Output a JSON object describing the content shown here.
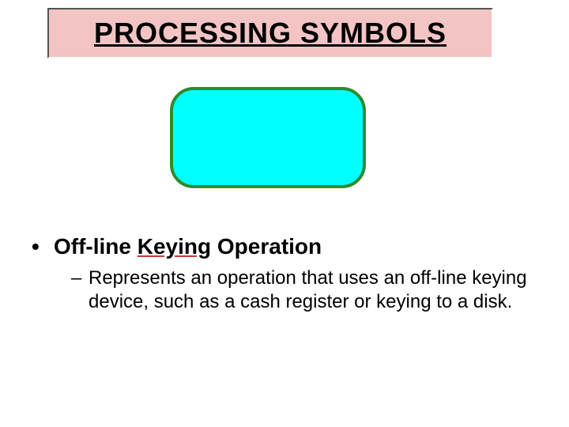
{
  "title": "PROCESSING SYMBOLS",
  "bullet": {
    "pre": "Off-line ",
    "keyword": "Keying",
    "post": " Operation"
  },
  "sub": "Represents an operation that uses an off-line keying device, such as a cash register or keying to a disk.",
  "marks": {
    "dot": "•",
    "dash": "–"
  }
}
